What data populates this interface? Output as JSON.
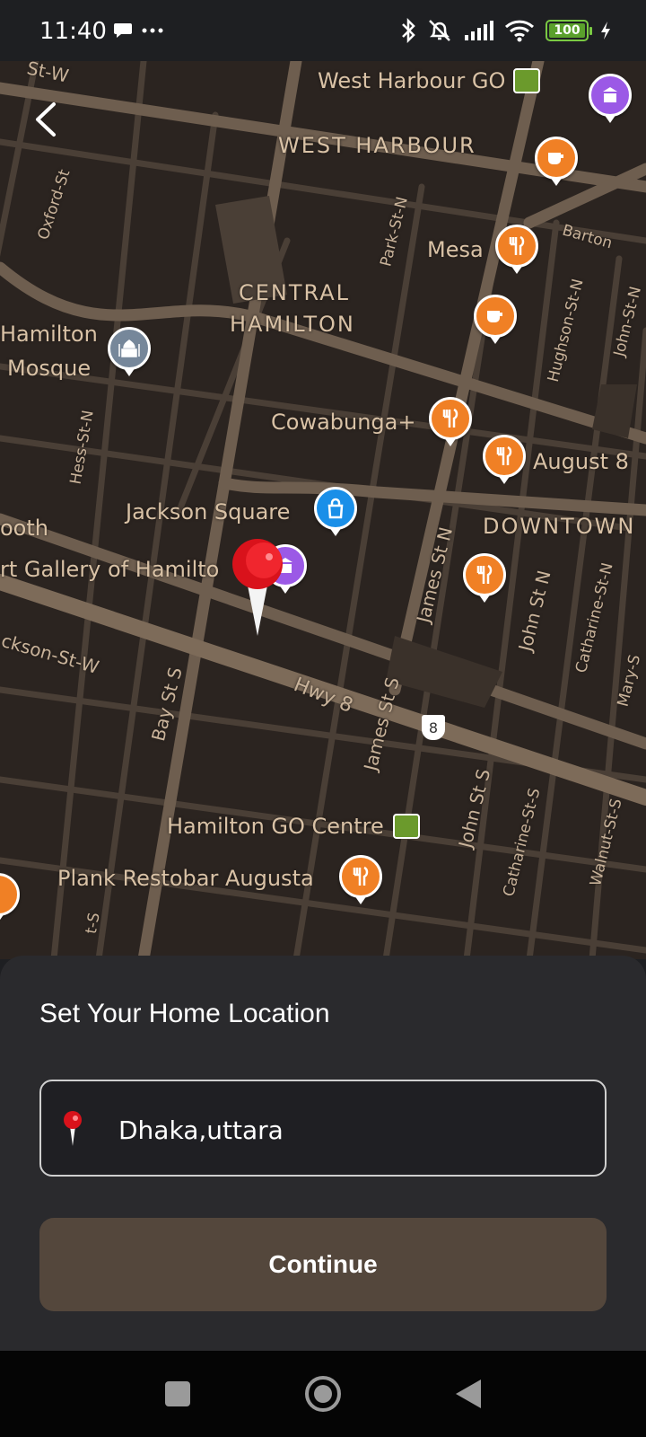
{
  "status_bar": {
    "time": "11:40",
    "battery": "100",
    "icons": [
      "chat-bubble-icon",
      "more-icon",
      "bluetooth-icon",
      "alarm-off-icon",
      "signal-icon",
      "wifi-icon",
      "battery-icon",
      "charging-icon"
    ]
  },
  "map": {
    "districts": [
      "WEST HARBOUR",
      "CENTRAL",
      "HAMILTON",
      "DOWNTOWN"
    ],
    "places": {
      "west_harbour_go": "West Harbour GO",
      "mesa": "Mesa",
      "hamilton": "Hamilton",
      "mosque": "Mosque",
      "cowabunga": "Cowabunga+",
      "august8": "August 8",
      "jackson_square": "Jackson Square",
      "booth": "ooth",
      "art_gallery": "rt Gallery of Hamilto",
      "hamilton_go_centre": "Hamilton GO Centre",
      "plank": "Plank Restobar Augusta"
    },
    "streets": {
      "oxford": "Oxford-St",
      "park": "Park-St-N",
      "barton": "Barton",
      "hughson": "Hughson-St-N",
      "john_n_top": "John-St-N",
      "hess": "Hess-St-N",
      "james_n": "James St N",
      "john_n": "John St N",
      "catharine_n": "Catharine-St-N",
      "mary": "Mary-S",
      "jackson_w": "ckson-St-W",
      "bay": "Bay St S",
      "hwy8": "Hwy 8",
      "james_s": "James St S",
      "john_s": "John St S",
      "catharine_s": "Catharine-St-S",
      "walnut": "Walnut-St-S",
      "st_w": "St-W",
      "corner_st": "t-S"
    },
    "highway_shield": "8",
    "colors": {
      "background": "#2b2420",
      "road": "#5e5044",
      "major_road": "#7d6b59",
      "label": "#d9c2a6",
      "poi_food": "#f08025",
      "poi_museum": "#9b59e6",
      "poi_shopping": "#1a8fe8",
      "poi_worship": "#76879a",
      "transit": "#6b9a2c",
      "pin": "#e31b23"
    }
  },
  "sheet": {
    "title": "Set Your Home Location",
    "location_value": "Dhaka,uttara",
    "continue_label": "Continue",
    "colors": {
      "sheet": "#2a2a2d",
      "button": "#54473c"
    }
  },
  "nav_bar": {
    "buttons": [
      "recents-button",
      "home-button",
      "back-button"
    ]
  }
}
